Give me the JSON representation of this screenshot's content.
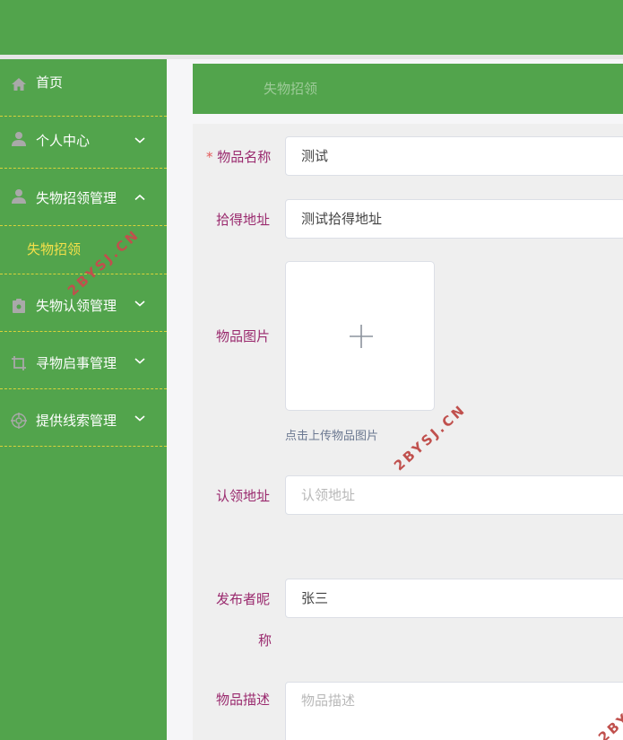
{
  "sidebar": {
    "items": [
      {
        "label": "首页",
        "icon": "home-icon"
      },
      {
        "label": "个人中心",
        "icon": "user-icon"
      },
      {
        "label": "失物招领管理",
        "icon": "user-icon",
        "expanded": true
      },
      {
        "label": "失物认领管理",
        "icon": "clipboard-icon"
      },
      {
        "label": "寻物启事管理",
        "icon": "crop-icon"
      },
      {
        "label": "提供线索管理",
        "icon": "target-icon"
      }
    ],
    "submenu": {
      "label": "失物招领"
    }
  },
  "breadcrumb": {
    "label": "失物招领"
  },
  "form": {
    "required_mark": "*",
    "item_name": {
      "label": "物品名称",
      "value": "测试"
    },
    "found_address": {
      "label": "拾得地址",
      "value": "测试拾得地址"
    },
    "item_image": {
      "label": "物品图片",
      "hint": "点击上传物品图片"
    },
    "claim_address": {
      "label": "认领地址",
      "placeholder": "认领地址"
    },
    "publisher_nickname": {
      "label_line1": "发布者昵",
      "label_line2": "称",
      "value": "张三"
    },
    "item_description": {
      "label": "物品描述",
      "placeholder": "物品描述"
    }
  },
  "watermark": {
    "text": "2BYSJ.CN",
    "partial_text": "2BY"
  },
  "colors": {
    "primary_green": "#52a44c",
    "label_purple": "#9a2a6e",
    "submenu_yellow": "#f5e04a",
    "divider_yellow": "#d9d23a",
    "required_red": "#e45b5b",
    "watermark_red": "#c0504d"
  }
}
